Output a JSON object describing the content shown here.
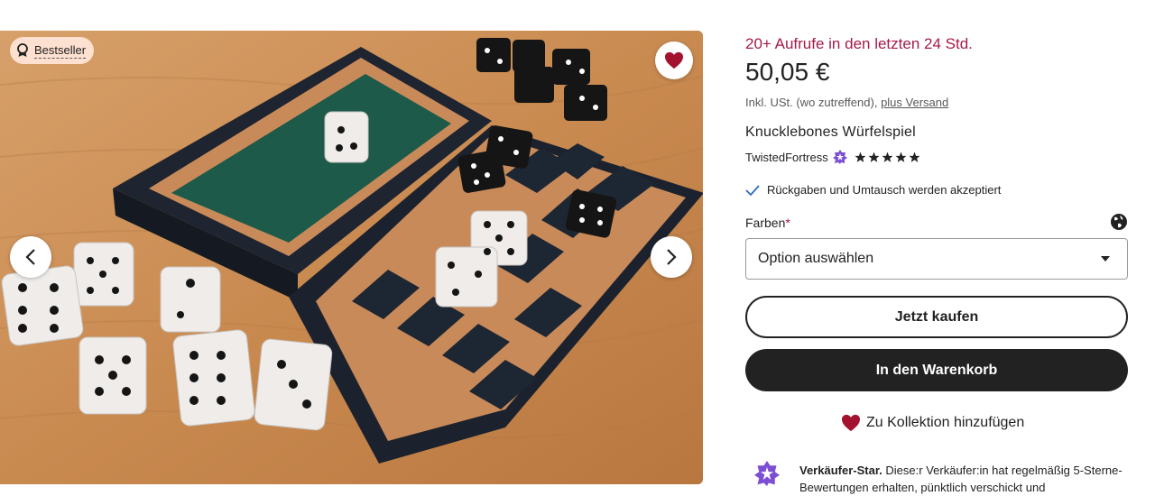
{
  "gallery": {
    "badge": "Bestseller",
    "badge_icon": "award-ribbon-icon",
    "favorite_icon": "heart-icon",
    "prev_icon": "chevron-left-icon",
    "next_icon": "chevron-right-icon",
    "image_description_icon": "product-photo"
  },
  "listing": {
    "views_notice": "20+ Aufrufe in den letzten 24 Std.",
    "price": "50,05 €",
    "tax_prefix": "Inkl. USt. (wo zutreffend),",
    "shipping_link": "plus Versand",
    "title": "Knucklebones Würfelspiel",
    "shop_name": "TwistedFortress",
    "rating": 5,
    "returns": "Rückgaben und Umtausch werden akzeptiert",
    "variation_label": "Farben",
    "variation_required": "*",
    "select_value": "Option auswählen",
    "buy_now": "Jetzt kaufen",
    "add_to_cart": "In den Warenkorb",
    "add_to_collection": "Zu Kollektion hinzufügen",
    "star_seller_title": "Verkäufer-Star.",
    "star_seller_text": "Diese:r Verkäufer:in hat regelmäßig 5-Sterne-Bewertungen erhalten, pünktlich verschickt und"
  },
  "colors": {
    "accent_red": "#a61a4a",
    "badge_bg": "#fde0cf",
    "primary_button": "#222222",
    "star_seller_purple": "#7c4ed4",
    "heart_red": "#a3132f"
  }
}
